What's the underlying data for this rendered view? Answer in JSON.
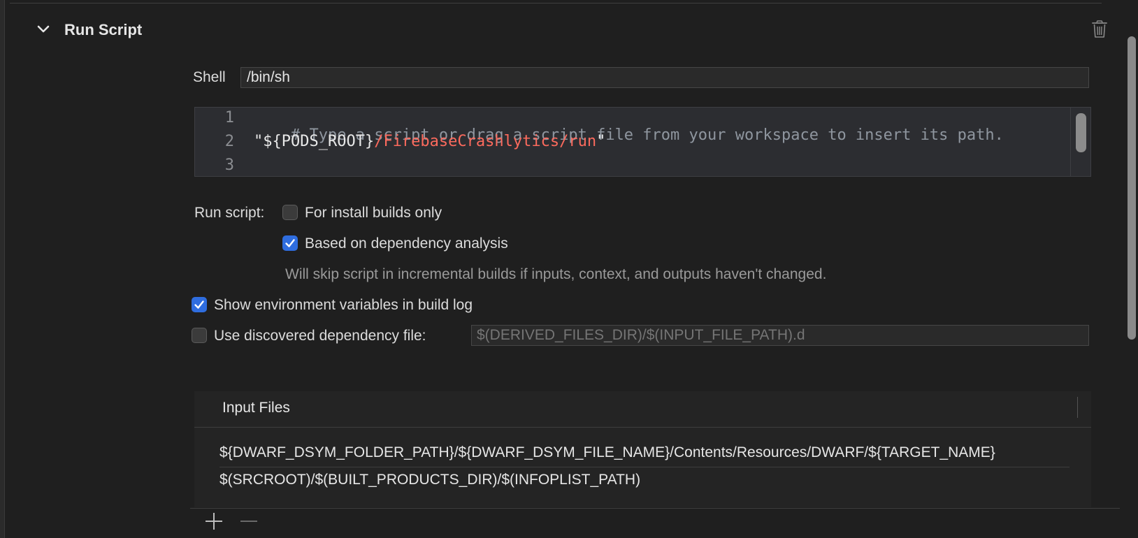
{
  "section": {
    "title": "Run Script"
  },
  "shell": {
    "label": "Shell",
    "value": "/bin/sh"
  },
  "script_editor": {
    "lines": [
      {
        "number": "1",
        "comment": "# Type a script or drag a script file from your workspace to insert its path."
      },
      {
        "number": "2",
        "quote_open": "\"",
        "var": "${PODS_ROOT}",
        "path": "/FirebaseCrashlytics/run",
        "quote_close": "\""
      },
      {
        "number": "3"
      }
    ]
  },
  "run_script": {
    "label": "Run script:",
    "install_builds_only": {
      "label": "For install builds only",
      "checked": false
    },
    "dependency_analysis": {
      "label": "Based on dependency analysis",
      "checked": true
    },
    "hint": "Will skip script in incremental builds if inputs, context, and outputs haven't changed."
  },
  "show_env": {
    "label": "Show environment variables in build log",
    "checked": true
  },
  "dep_file": {
    "label": "Use discovered dependency file:",
    "checked": false,
    "placeholder": "$(DERIVED_FILES_DIR)/$(INPUT_FILE_PATH).d"
  },
  "input_files": {
    "header": "Input Files",
    "rows": [
      "${DWARF_DSYM_FOLDER_PATH}/${DWARF_DSYM_FILE_NAME}/Contents/Resources/DWARF/${TARGET_NAME}",
      "$(SRCROOT)/$(BUILT_PRODUCTS_DIR)/$(INFOPLIST_PATH)"
    ]
  },
  "colors": {
    "accent": "#2f6ddf",
    "string_red": "#fc6a5d",
    "background": "#1f1f1f"
  },
  "icons": {
    "collapse": "chevron-down-icon",
    "delete": "trash-icon",
    "add": "plus-icon",
    "remove": "minus-icon",
    "check": "checkmark-icon"
  }
}
